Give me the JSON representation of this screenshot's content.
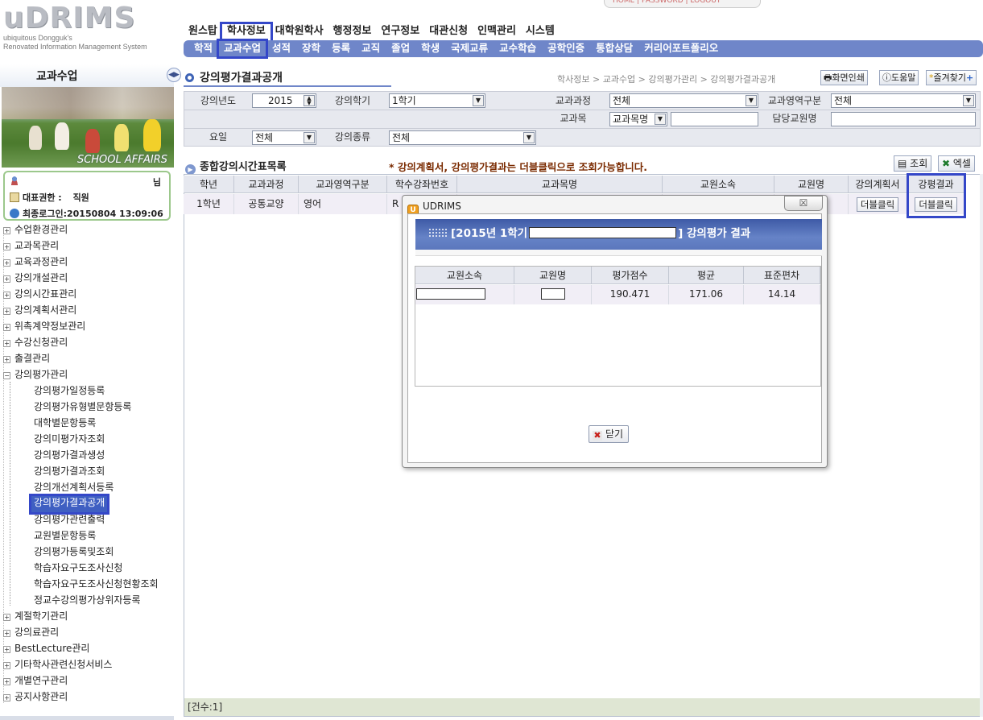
{
  "app": {
    "logo_text": "uDRIMS",
    "logo_sub1": "ubiquitous Dongguk's",
    "logo_sub2": "Renovated Information Management System",
    "top_links": "HOME  |  PASSWORD  |  LOGOUT"
  },
  "main_menu": [
    "원스탑",
    "학사정보",
    "대학원학사",
    "행정정보",
    "연구정보",
    "대관신청",
    "인맥관리",
    "시스템"
  ],
  "sub_menu": [
    "학적",
    "교과수업",
    "성적",
    "장학",
    "등록",
    "교직",
    "졸업",
    "학생",
    "국제교류",
    "교수학습",
    "공학인증",
    "통합상담",
    "커리어포트폴리오"
  ],
  "left_panel": {
    "title": "교과수업",
    "banner_caption": "SCHOOL AFFAIRS",
    "user_suffix": "님",
    "role_label": "대표권한 :",
    "role_value": "직원",
    "last_login_label": "최종로그인:",
    "last_login_value": "20150804 13:09:06"
  },
  "tree": {
    "top_items": [
      "수업환경관리",
      "교과목관리",
      "교육과정관리",
      "강의개설관리",
      "강의시간표관리",
      "강의계획서관리",
      "위촉계약정보관리",
      "수강신청관리",
      "출결관리",
      "강의평가관리"
    ],
    "children": [
      "강의평가일정등록",
      "강의평가유형별문항등록",
      "대학별문항등록",
      "강의미평가자조회",
      "강의평가결과생성",
      "강의평가결과조회",
      "강의개선계획서등록",
      "강의평가결과공개",
      "강의평가관련출력",
      "교원별문항등록",
      "강의평가등록및조회",
      "학습자요구도조사신청",
      "학습자요구도조사신청현황조회",
      "정교수강의평가상위자등록"
    ],
    "bottom_items": [
      "계절학기관리",
      "강의료관리",
      "BestLecture관리",
      "기타학사관련신청서비스",
      "개별연구관리",
      "공지사항관리"
    ]
  },
  "page": {
    "title": "강의평가결과공개",
    "breadcrumb": "학사정보 > 교과수업 > 강의평가관리 > 강의평가결과공개",
    "btn_print": "화면인쇄",
    "btn_help": "도움말",
    "btn_fav": "즐겨찾기"
  },
  "filter": {
    "year_label": "강의년도",
    "year_value": "2015",
    "term_label": "강의학기",
    "term_value": "1학기",
    "course_label": "교과과정",
    "course_value": "전체",
    "area_label": "교과영역구분",
    "area_value": "전체",
    "subject_label": "교과목",
    "subject_select": "교과목명",
    "subject_input": "",
    "prof_label": "담당교원명",
    "prof_input": "",
    "day_label": "요일",
    "day_value": "전체",
    "kind_label": "강의종류",
    "kind_value": "전체"
  },
  "list": {
    "title": "종합강의시간표목록",
    "note": "* 강의계획서, 강의평가결과는 더블클릭으로 조회가능합니다.",
    "btn_search": "조회",
    "btn_excel": "엑셀",
    "columns": [
      "학년",
      "교과과정",
      "교과영역구분",
      "학수강좌번호",
      "교과목명",
      "교원소속",
      "교원명",
      "강의계획서",
      "강평결과"
    ],
    "row": {
      "year": "1학년",
      "course": "공통교양",
      "area": "영어",
      "code": "R",
      "plan_btn": "더블클릭",
      "result_btn": "더블클릭"
    },
    "footer": "[건수:1]"
  },
  "modal": {
    "window_title": "UDRIMS",
    "close_x": "☒",
    "header_prefix": "[2015년 1학기",
    "header_suffix": "] 강의평가 결과",
    "columns": [
      "교원소속",
      "교원명",
      "평가점수",
      "평균",
      "표준편차"
    ],
    "row": {
      "score": "190.471",
      "avg": "171.06",
      "std": "14.14"
    },
    "close_btn": "닫기"
  }
}
